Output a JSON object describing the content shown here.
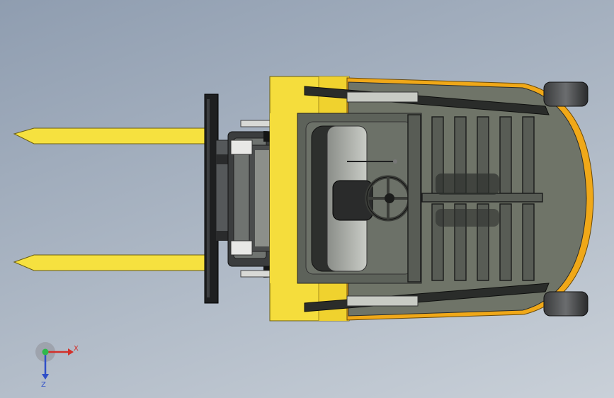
{
  "colors": {
    "body_yellow": "#f5dd3c",
    "fork_yellow": "#f6e13f",
    "orange_trim": "#f0a818",
    "frame_gray": "#6f7468",
    "dark": "#1e1f20",
    "x_axis": "#d2302a",
    "y_axis": "#2fb84a",
    "z_axis": "#2f4fc8"
  },
  "triad": {
    "x_label": "X",
    "z_label": "Z"
  }
}
